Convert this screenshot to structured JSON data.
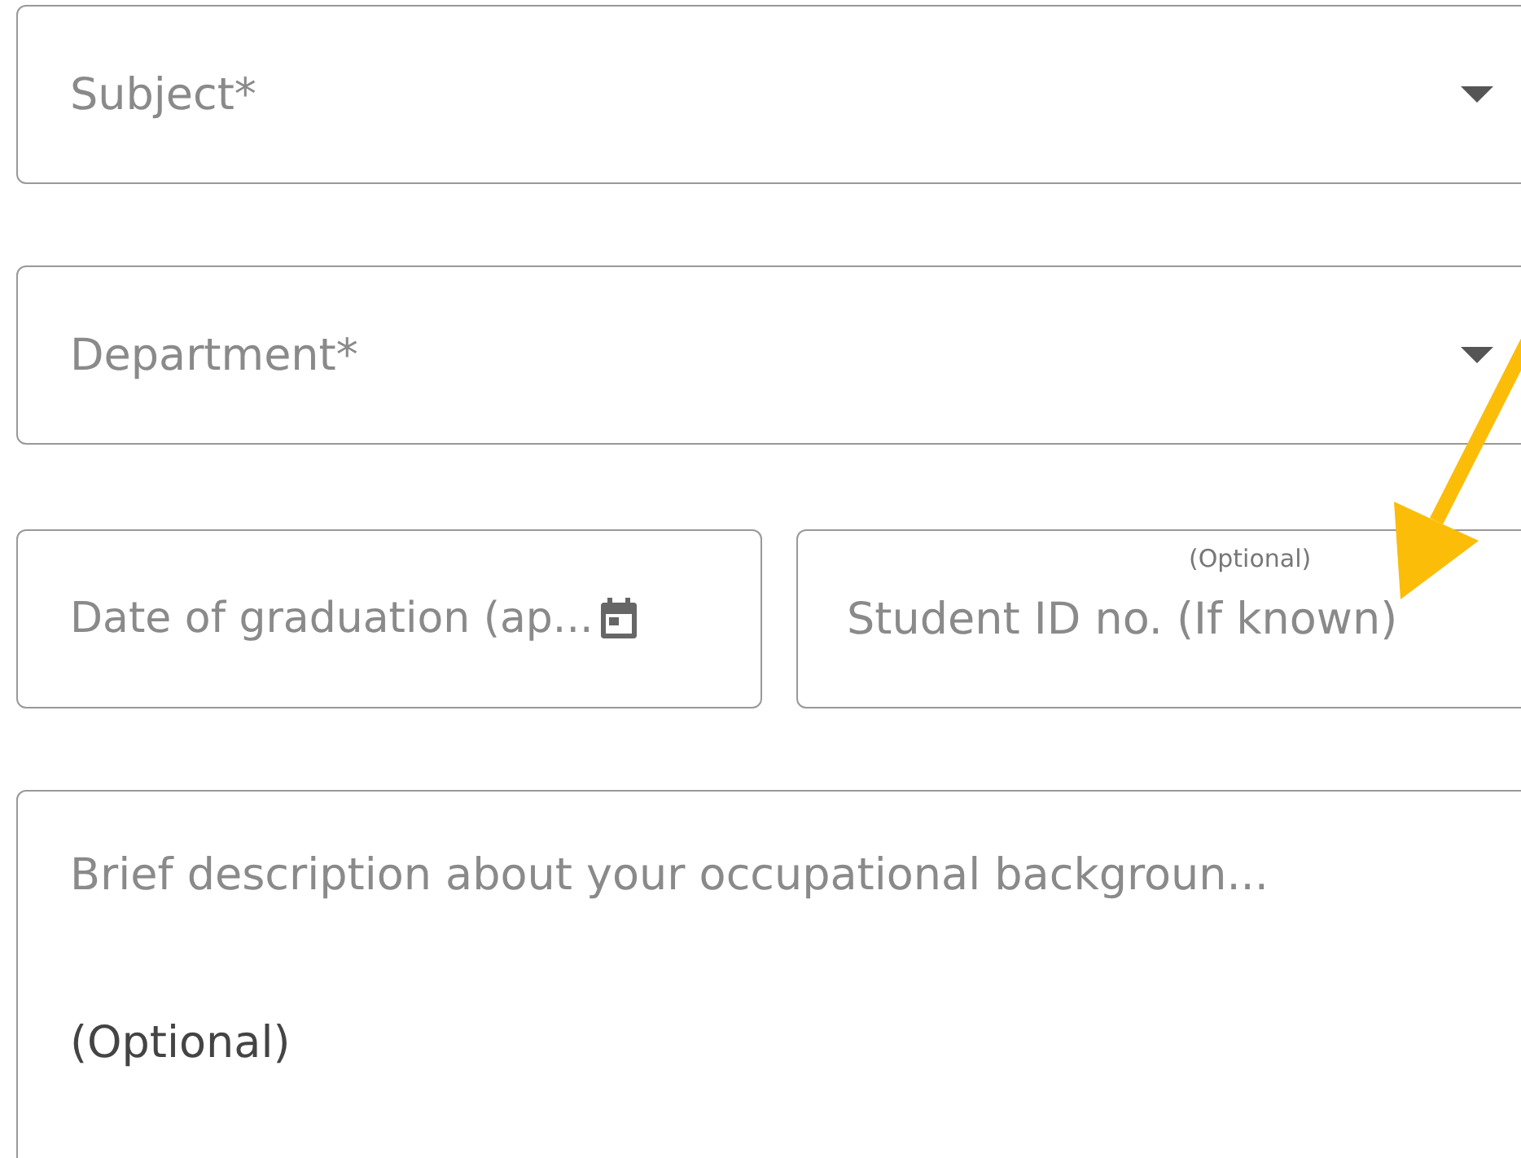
{
  "subject": {
    "placeholder": "Subject*"
  },
  "department": {
    "placeholder": "Department*"
  },
  "graduation_date": {
    "placeholder": "Date of graduation (ap..."
  },
  "student_id": {
    "placeholder": "Student ID no. (If known)",
    "hint": "(Optional)"
  },
  "description": {
    "placeholder": "Brief description about your occupational backgroun...",
    "note": "(Optional)"
  }
}
